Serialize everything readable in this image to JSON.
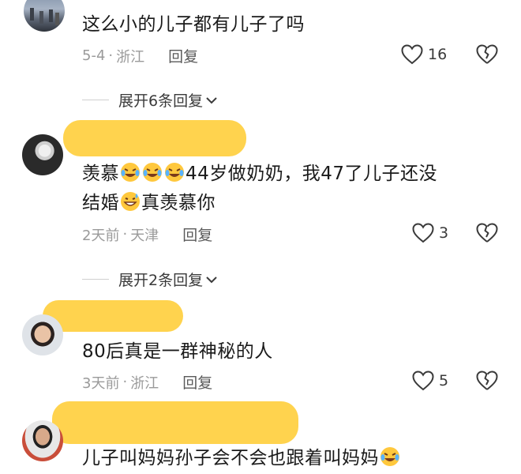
{
  "comments": [
    {
      "text": "这么小的儿子都有儿子了吗",
      "date": "5-4",
      "location": "浙江",
      "reply_label": "回复",
      "likes": "16"
    },
    {
      "text_a": "羡慕",
      "text_b": "44岁做奶奶，我47了儿子还没",
      "text_c": "结婚",
      "text_d": "真羡慕你",
      "date": "2天前",
      "location": "天津",
      "reply_label": "回复",
      "likes": "3"
    },
    {
      "text": "80后真是一群神秘的人",
      "date": "3天前",
      "location": "浙江",
      "reply_label": "回复",
      "likes": "5"
    },
    {
      "text": "儿子叫妈妈孙子会不会也跟着叫妈妈"
    }
  ],
  "expanders": [
    {
      "label": "展开6条回复"
    },
    {
      "label": "展开2条回复"
    }
  ],
  "meta_separator": "·",
  "colors": {
    "highlight": "#ffcf3f",
    "meta": "#9a9a9a",
    "text": "#1a1a1a"
  },
  "icons": [
    "heart-icon",
    "broken-heart-icon",
    "chevron-down-icon",
    "laugh-cry-emoji",
    "grin-sweat-emoji"
  ]
}
